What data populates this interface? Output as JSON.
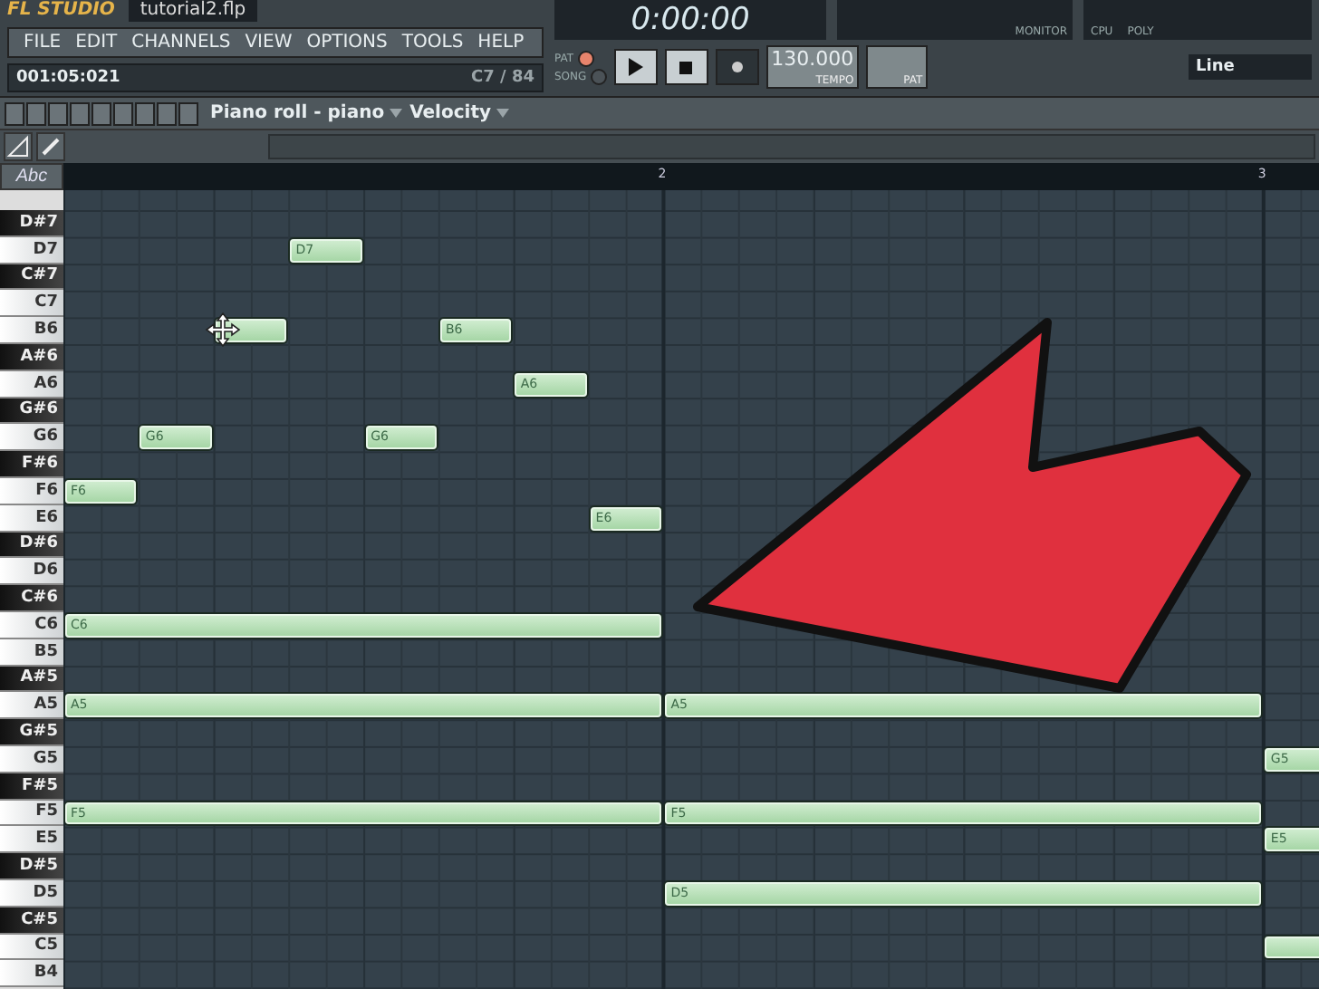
{
  "title_bar": {
    "app": "FL STUDIO",
    "file": "tutorial2.flp"
  },
  "menu": [
    "FILE",
    "EDIT",
    "CHANNELS",
    "VIEW",
    "OPTIONS",
    "TOOLS",
    "HELP"
  ],
  "hint_bar": {
    "position": "001:05:021",
    "note": "C7 / 84"
  },
  "transport": {
    "time": "0:00:00",
    "tempo": "130.000",
    "tempo_label": "TEMPO",
    "pattern_label": "PAT",
    "monitor_label": "MONITOR",
    "cpu_label": "CPU",
    "poly_label": "POLY",
    "snap": "Line"
  },
  "modes": [
    {
      "label": "PAT",
      "selected": true
    },
    {
      "label": "SONG",
      "selected": false
    }
  ],
  "toolbar": {
    "title": "Piano roll - piano",
    "target": "Velocity"
  },
  "abc_button": "Abc",
  "timeline": [
    "2",
    "3"
  ],
  "keys": [
    {
      "name": "D#7",
      "kind": "black"
    },
    {
      "name": "D7",
      "kind": "white"
    },
    {
      "name": "C#7",
      "kind": "black"
    },
    {
      "name": "C7",
      "kind": "white"
    },
    {
      "name": "B6",
      "kind": "white"
    },
    {
      "name": "A#6",
      "kind": "black"
    },
    {
      "name": "A6",
      "kind": "white"
    },
    {
      "name": "G#6",
      "kind": "black"
    },
    {
      "name": "G6",
      "kind": "white"
    },
    {
      "name": "F#6",
      "kind": "black"
    },
    {
      "name": "F6",
      "kind": "white"
    },
    {
      "name": "E6",
      "kind": "white"
    },
    {
      "name": "D#6",
      "kind": "black"
    },
    {
      "name": "D6",
      "kind": "white"
    },
    {
      "name": "C#6",
      "kind": "black"
    },
    {
      "name": "C6",
      "kind": "white"
    },
    {
      "name": "B5",
      "kind": "white"
    },
    {
      "name": "A#5",
      "kind": "black"
    },
    {
      "name": "A5",
      "kind": "white"
    },
    {
      "name": "G#5",
      "kind": "black"
    },
    {
      "name": "G5",
      "kind": "white"
    },
    {
      "name": "F#5",
      "kind": "black"
    },
    {
      "name": "F5",
      "kind": "white"
    },
    {
      "name": "E5",
      "kind": "white"
    },
    {
      "name": "D#5",
      "kind": "black"
    },
    {
      "name": "D5",
      "kind": "white"
    },
    {
      "name": "C#5",
      "kind": "black"
    },
    {
      "name": "C5",
      "kind": "white"
    },
    {
      "name": "B4",
      "kind": "white"
    }
  ],
  "notes": [
    {
      "kind": "labeled",
      "label": "D7"
    },
    {
      "kind": "covered"
    },
    {
      "kind": "labeled",
      "label": "B6"
    },
    {
      "kind": "labeled",
      "label": "A6"
    },
    {
      "kind": "labeled",
      "label": "G6"
    },
    {
      "kind": "labeled",
      "label": "G6"
    },
    {
      "kind": "labeled",
      "label": "F6"
    },
    {
      "kind": "labeled",
      "label": "E6"
    },
    {
      "kind": "labeled",
      "label": "C6"
    },
    {
      "kind": "labeled",
      "label": "A5"
    },
    {
      "kind": "labeled",
      "label": "A5"
    },
    {
      "kind": "labeled",
      "label": "G5"
    },
    {
      "kind": "labeled",
      "label": "F5"
    },
    {
      "kind": "labeled",
      "label": "F5"
    },
    {
      "kind": "labeled",
      "label": "E5"
    },
    {
      "kind": "labeled",
      "label": "D5"
    },
    {
      "kind": "covered"
    }
  ]
}
